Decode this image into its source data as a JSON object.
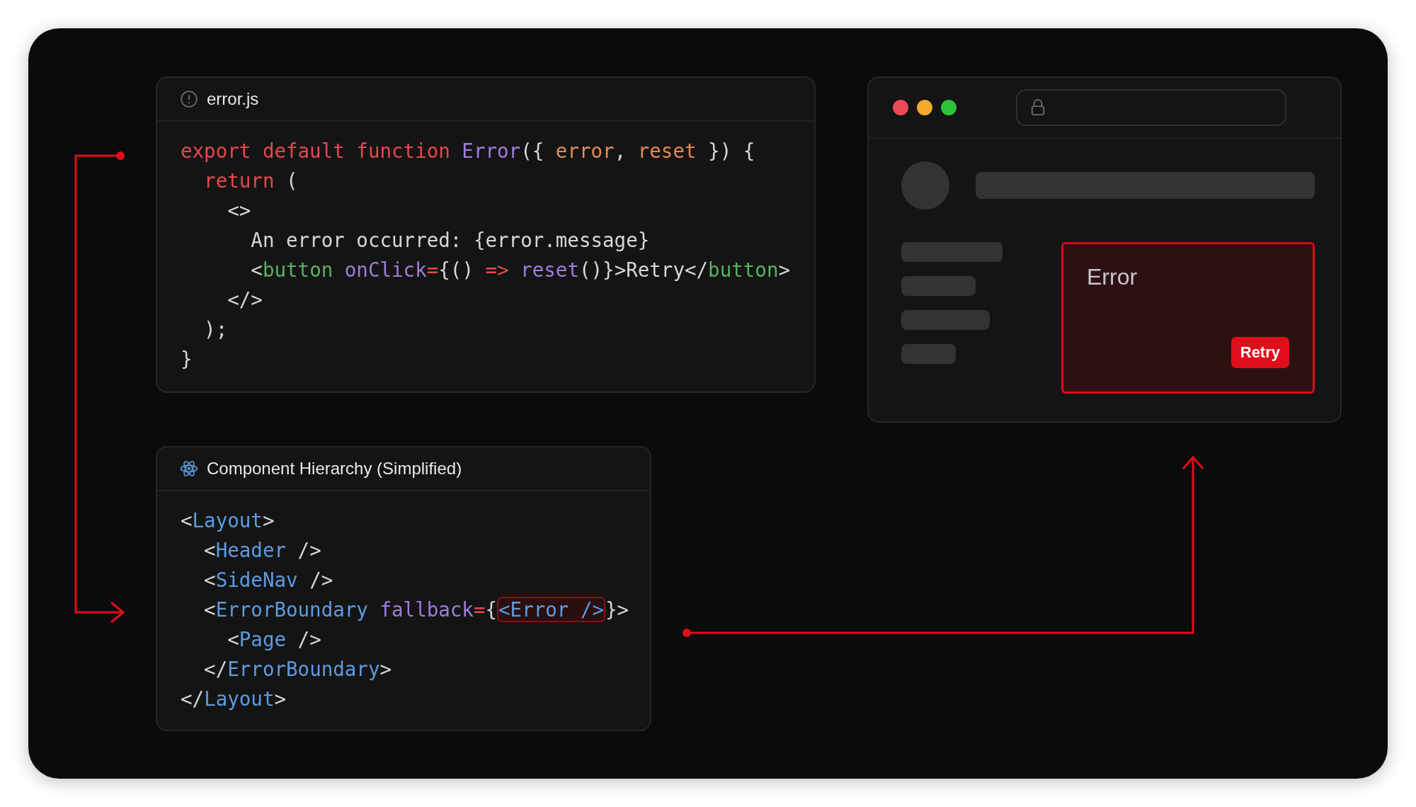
{
  "code_panel": {
    "filename": "error.js",
    "lines": [
      [
        {
          "t": "export default function ",
          "kind": "keyword"
        },
        {
          "t": "Error",
          "kind": "function"
        },
        {
          "t": "({ ",
          "kind": "plain"
        },
        {
          "t": "error",
          "kind": "param"
        },
        {
          "t": ", ",
          "kind": "plain"
        },
        {
          "t": "reset",
          "kind": "param"
        },
        {
          "t": " }) {",
          "kind": "plain"
        }
      ],
      [
        {
          "t": "  return",
          "kind": "keyword"
        },
        {
          "t": " (",
          "kind": "plain"
        }
      ],
      [
        {
          "t": "    <>",
          "kind": "plain"
        }
      ],
      [
        {
          "t": "      An error occurred: {error.message}",
          "kind": "plain"
        }
      ],
      [
        {
          "t": "      <",
          "kind": "plain"
        },
        {
          "t": "button",
          "kind": "tag"
        },
        {
          "t": " onClick",
          "kind": "function"
        },
        {
          "t": "=",
          "kind": "keyword"
        },
        {
          "t": "{() ",
          "kind": "plain"
        },
        {
          "t": "=>",
          "kind": "keyword"
        },
        {
          "t": " reset",
          "kind": "function"
        },
        {
          "t": "()}>Retry</",
          "kind": "plain"
        },
        {
          "t": "button",
          "kind": "tag"
        },
        {
          "t": ">",
          "kind": "plain"
        }
      ],
      [
        {
          "t": "    </>",
          "kind": "plain"
        }
      ],
      [
        {
          "t": "  );",
          "kind": "plain"
        }
      ],
      [
        {
          "t": "}",
          "kind": "plain"
        }
      ]
    ]
  },
  "hierarchy_panel": {
    "title": "Component Hierarchy (Simplified)",
    "lines": [
      [
        {
          "t": "<",
          "kind": "plain"
        },
        {
          "t": "Layout",
          "kind": "component"
        },
        {
          "t": ">",
          "kind": "plain"
        }
      ],
      [
        {
          "t": "  <",
          "kind": "plain"
        },
        {
          "t": "Header",
          "kind": "component"
        },
        {
          "t": " />",
          "kind": "plain"
        }
      ],
      [
        {
          "t": "  <",
          "kind": "plain"
        },
        {
          "t": "SideNav",
          "kind": "component"
        },
        {
          "t": " />",
          "kind": "plain"
        }
      ],
      [
        {
          "t": "  <",
          "kind": "plain"
        },
        {
          "t": "ErrorBoundary",
          "kind": "component"
        },
        {
          "t": " fallback",
          "kind": "function"
        },
        {
          "t": "=",
          "kind": "keyword"
        },
        {
          "t": "{",
          "kind": "plain"
        },
        {
          "t": "<Error />",
          "kind": "component",
          "highlighted": true
        },
        {
          "t": "}>",
          "kind": "plain"
        }
      ],
      [
        {
          "t": "    <",
          "kind": "plain"
        },
        {
          "t": "Page",
          "kind": "component"
        },
        {
          "t": " />",
          "kind": "plain"
        }
      ],
      [
        {
          "t": "  </",
          "kind": "plain"
        },
        {
          "t": "ErrorBoundary",
          "kind": "component"
        },
        {
          "t": ">",
          "kind": "plain"
        }
      ],
      [
        {
          "t": "</",
          "kind": "plain"
        },
        {
          "t": "Layout",
          "kind": "component"
        },
        {
          "t": ">",
          "kind": "plain"
        }
      ]
    ]
  },
  "browser": {
    "error_card": {
      "title": "Error",
      "button": "Retry"
    }
  }
}
